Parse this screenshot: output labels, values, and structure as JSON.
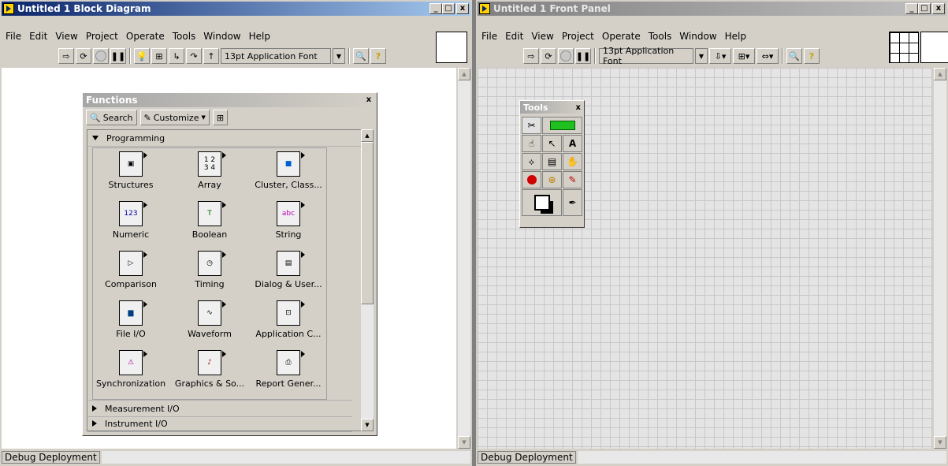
{
  "block_diagram": {
    "title": "Untitled 1 Block Diagram",
    "menu": [
      "File",
      "Edit",
      "View",
      "Project",
      "Operate",
      "Tools",
      "Window",
      "Help"
    ],
    "font_select": "13pt Application Font",
    "status": "Debug Deployment",
    "functions_palette": {
      "title": "Functions",
      "search_label": "Search",
      "customize_label": "Customize",
      "category_programming": "Programming",
      "items": [
        {
          "label": "Structures",
          "icon": "structures-icon"
        },
        {
          "label": "Array",
          "icon": "array-icon"
        },
        {
          "label": "Cluster, Class...",
          "icon": "cluster-icon"
        },
        {
          "label": "Numeric",
          "icon": "numeric-icon"
        },
        {
          "label": "Boolean",
          "icon": "boolean-icon"
        },
        {
          "label": "String",
          "icon": "string-icon"
        },
        {
          "label": "Comparison",
          "icon": "comparison-icon"
        },
        {
          "label": "Timing",
          "icon": "timing-icon"
        },
        {
          "label": "Dialog & User...",
          "icon": "dialog-icon"
        },
        {
          "label": "File I/O",
          "icon": "file-io-icon"
        },
        {
          "label": "Waveform",
          "icon": "waveform-icon"
        },
        {
          "label": "Application C...",
          "icon": "application-control-icon"
        },
        {
          "label": "Synchronization",
          "icon": "synchronization-icon"
        },
        {
          "label": "Graphics & So...",
          "icon": "graphics-sound-icon"
        },
        {
          "label": "Report Gener...",
          "icon": "report-generation-icon"
        }
      ],
      "collapsed_categories": [
        "Measurement I/O",
        "Instrument I/O"
      ]
    }
  },
  "front_panel": {
    "title": "Untitled 1 Front Panel",
    "menu": [
      "File",
      "Edit",
      "View",
      "Project",
      "Operate",
      "Tools",
      "Window",
      "Help"
    ],
    "font_select": "13pt Application Font",
    "status": "Debug Deployment",
    "tools_palette": {
      "title": "Tools"
    }
  },
  "colors": {
    "active_title": "#0a246a",
    "inactive_title": "#808080",
    "grid": "#c8c8c8"
  }
}
